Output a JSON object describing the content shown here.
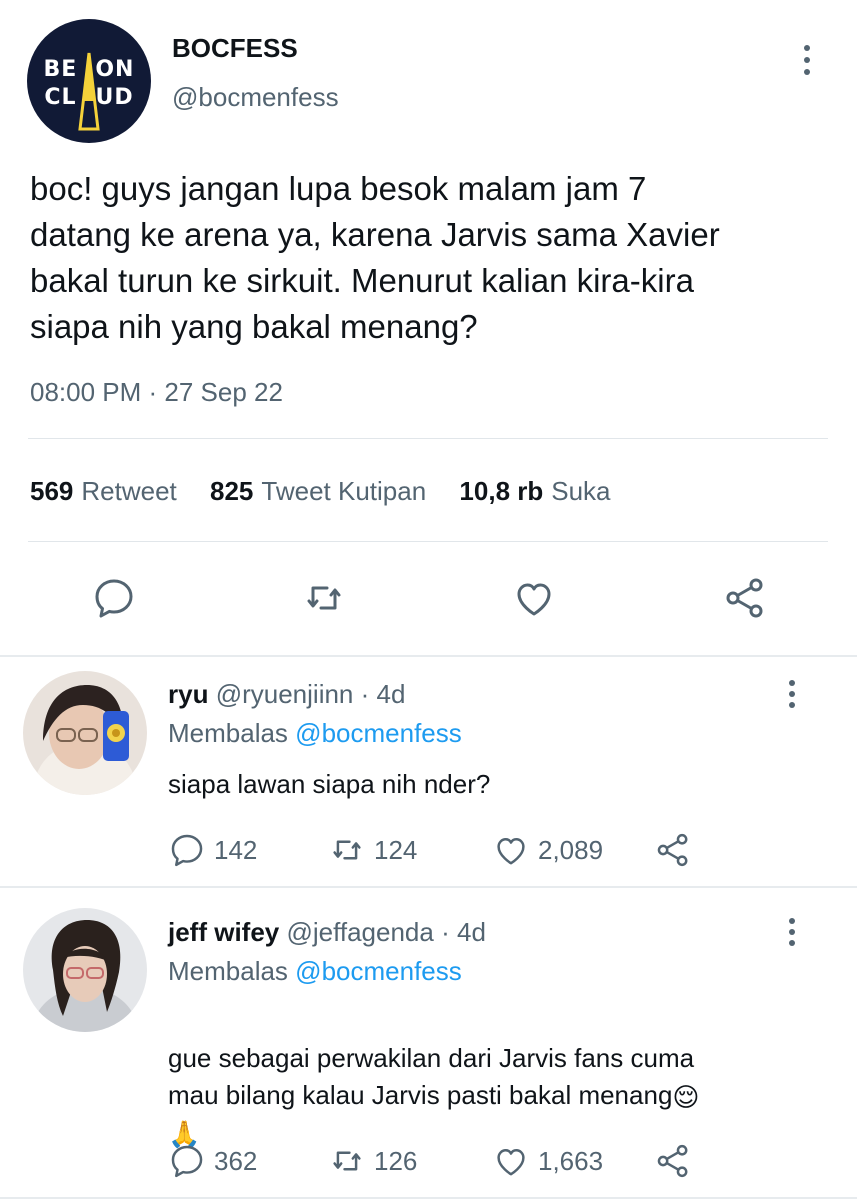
{
  "main_tweet": {
    "avatar_logo": {
      "line1": "BEACON",
      "line2": "CLOUD"
    },
    "display_name": "BOCFESS",
    "handle": "@bocmenfess",
    "text": "boc! guys jangan lupa besok malam jam 7\ndatang ke arena ya, karena Jarvis sama Xavier\nbakal turun ke sirkuit. Menurut kalian kira-kira\nsiapa nih yang bakal menang?",
    "timestamp": "08:00 PM · 27 Sep 22",
    "stats": {
      "retweets": {
        "count": "569",
        "label": "Retweet"
      },
      "quotes": {
        "count": "825",
        "label": "Tweet Kutipan"
      },
      "likes": {
        "count": "10,8 rb",
        "label": "Suka"
      }
    },
    "actions": [
      "reply-icon",
      "retweet-icon",
      "like-icon",
      "share-icon"
    ]
  },
  "replies": [
    {
      "name": "ryu",
      "handle": "@ryuenjiinn",
      "dot": "·",
      "time": "4d",
      "replying_label": "Membalas",
      "replying_to": "@bocmenfess",
      "text": "siapa lawan siapa nih nder?",
      "emoji_line": "",
      "replies_count": "142",
      "retweets_count": "124",
      "likes_count": "2,089"
    },
    {
      "name": "jeff wifey",
      "handle": "@jeffagenda",
      "dot": "·",
      "time": "4d",
      "replying_label": "Membalas",
      "replying_to": "@bocmenfess",
      "text": "gue sebagai perwakilan dari Jarvis fans cuma\nmau bilang kalau Jarvis pasti bakal menang",
      "emoji_inline": "😌",
      "emoji_line": "🙏",
      "replies_count": "362",
      "retweets_count": "126",
      "likes_count": "1,663"
    }
  ],
  "colors": {
    "text": "#0f1419",
    "secondary": "#536471",
    "link": "#1d9bf0",
    "logo_bg": "#111a36",
    "logo_accent": "#f5d23a"
  }
}
